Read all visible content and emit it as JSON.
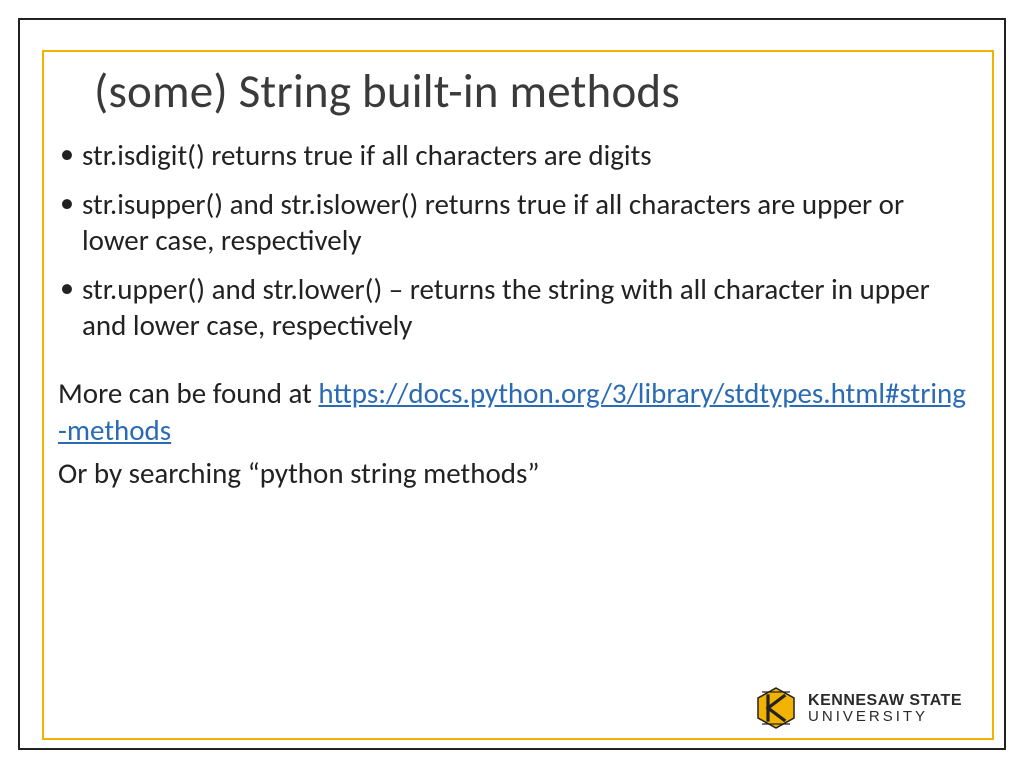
{
  "title": "(some) String built-in methods",
  "bullets": [
    "str.isdigit() returns true if all characters are digits",
    "str.isupper() and str.islower() returns true if all characters are upper or lower case, respectively",
    "str.upper() and str.lower() – returns the string with all character in upper and lower case, respectively"
  ],
  "more_intro": "More can be found at ",
  "more_link": "https://docs.python.org/3/library/stdtypes.html#string-methods",
  "search_line": "Or by searching “python string methods”",
  "logo": {
    "line1": "KENNESAW STATE",
    "line2": "UNIVERSITY"
  }
}
